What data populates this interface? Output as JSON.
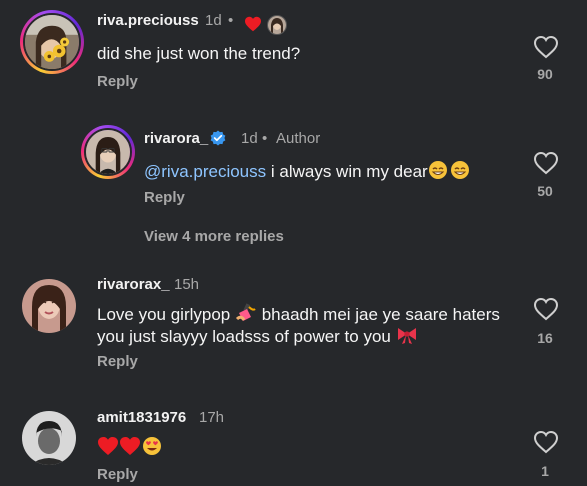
{
  "comments": [
    {
      "username": "riva.preciouss",
      "time": "1d",
      "separator": "•",
      "text": "did she just won the trend?",
      "reply_label": "Reply",
      "likes": "90"
    },
    {
      "username": "rivarora_",
      "time": "1d",
      "separator": "•",
      "author_label": "Author",
      "mention": "@riva.preciouss",
      "text": " i always win my dear",
      "reply_label": "Reply",
      "likes": "50"
    },
    {
      "username": "rivarorax_",
      "time": "15h",
      "text_part1": "Love you girlypop ",
      "text_part2": " bhaadh mei jae ye saare haters you just slayyy loadsss of power to you ",
      "reply_label": "Reply",
      "likes": "16"
    },
    {
      "username": "amit1831976",
      "time": "17h",
      "reply_label": "Reply",
      "likes": "1"
    }
  ],
  "view_more": "View 4 more replies",
  "icons": {
    "like": "heart-outline-icon",
    "liked_by_author": "heart-filled-icon",
    "verified": "verified-badge-icon"
  },
  "colors": {
    "background": "#26282b",
    "mention": "#8ec5ff",
    "verified": "#3897f0",
    "heart_red": "#ed1c24"
  }
}
